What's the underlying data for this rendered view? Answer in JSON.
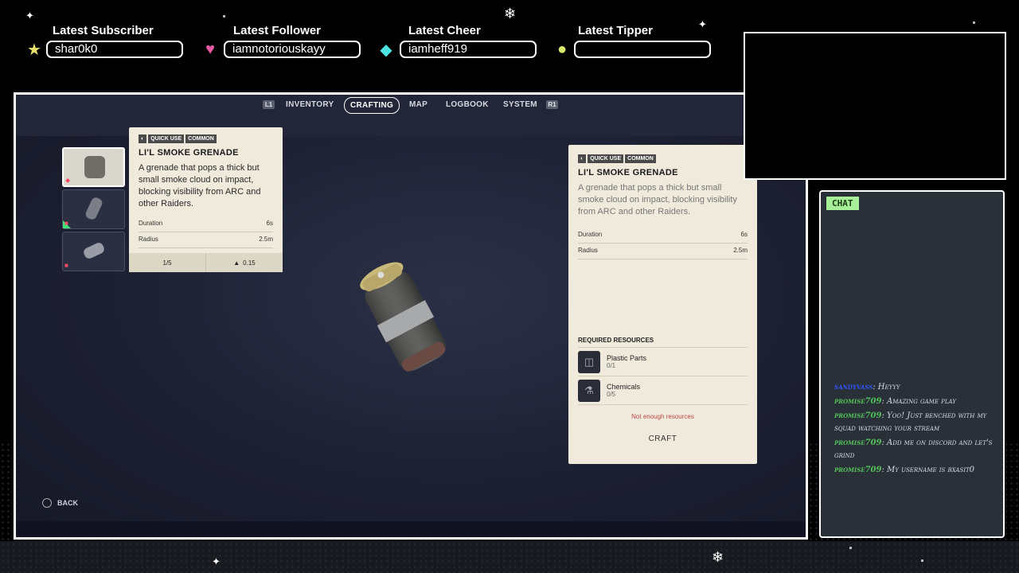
{
  "overlay": {
    "alerts": [
      {
        "label": "Latest Subscriber",
        "value": "shar0k0",
        "icon": "star-icon",
        "color": "#e8e26b"
      },
      {
        "label": "Latest Follower",
        "value": "iamnotoriouskayy",
        "icon": "heart-icon",
        "color": "#e75ba6"
      },
      {
        "label": "Latest Cheer",
        "value": "iamheff919",
        "icon": "gem-icon",
        "color": "#4ee3e0"
      },
      {
        "label": "Latest Tipper",
        "value": "",
        "icon": "coin-icon",
        "color": "#d8e86a"
      }
    ]
  },
  "game": {
    "nav": {
      "left_button": "L1",
      "right_button": "R1",
      "tabs": [
        {
          "label": "INVENTORY"
        },
        {
          "label": "CRAFTING"
        },
        {
          "label": "MAP"
        },
        {
          "label": "LOGBOOK"
        },
        {
          "label": "SYSTEM"
        }
      ],
      "active_tab": "CRAFTING"
    },
    "tooltip": {
      "tags": [
        "QUICK USE",
        "COMMON"
      ],
      "title": "LI'L SMOKE GRENADE",
      "description": "A grenade that pops a thick but small smoke cloud on impact, blocking visibility from ARC and other Raiders.",
      "stats": [
        {
          "name": "Duration",
          "value": "6s"
        },
        {
          "name": "Radius",
          "value": "2.5m"
        }
      ],
      "stack": "1/5",
      "weight": "0.15"
    },
    "detail": {
      "tags": [
        "QUICK USE",
        "COMMON"
      ],
      "title": "LI'L SMOKE GRENADE",
      "description": "A grenade that pops a thick but small smoke cloud on impact, blocking visibility from ARC and other Raiders.",
      "stats": [
        {
          "name": "Duration",
          "value": "6s"
        },
        {
          "name": "Radius",
          "value": "2.5m"
        }
      ],
      "resources_heading": "REQUIRED RESOURCES",
      "resources": [
        {
          "name": "Plastic Parts",
          "qty": "0/1"
        },
        {
          "name": "Chemicals",
          "qty": "0/5"
        }
      ],
      "warning": "Not enough resources",
      "craft_label": "CRAFT"
    },
    "back_label": "BACK"
  },
  "chat": {
    "title": "CHAT",
    "messages": [
      {
        "user": "sandyvass",
        "text": "Heyyy",
        "color": "#2f56ff"
      },
      {
        "user": "promise709",
        "text": "Amazing game play",
        "color": "#53c25a"
      },
      {
        "user": "promise709",
        "text": "Yoo! Just benched with my squad watching your stream",
        "color": "#53c25a"
      },
      {
        "user": "promise709",
        "text": "Add me on discord and let's grind",
        "color": "#53c25a"
      },
      {
        "user": "promise709",
        "text": "My username is bxasit0",
        "color": "#53c25a"
      }
    ]
  }
}
